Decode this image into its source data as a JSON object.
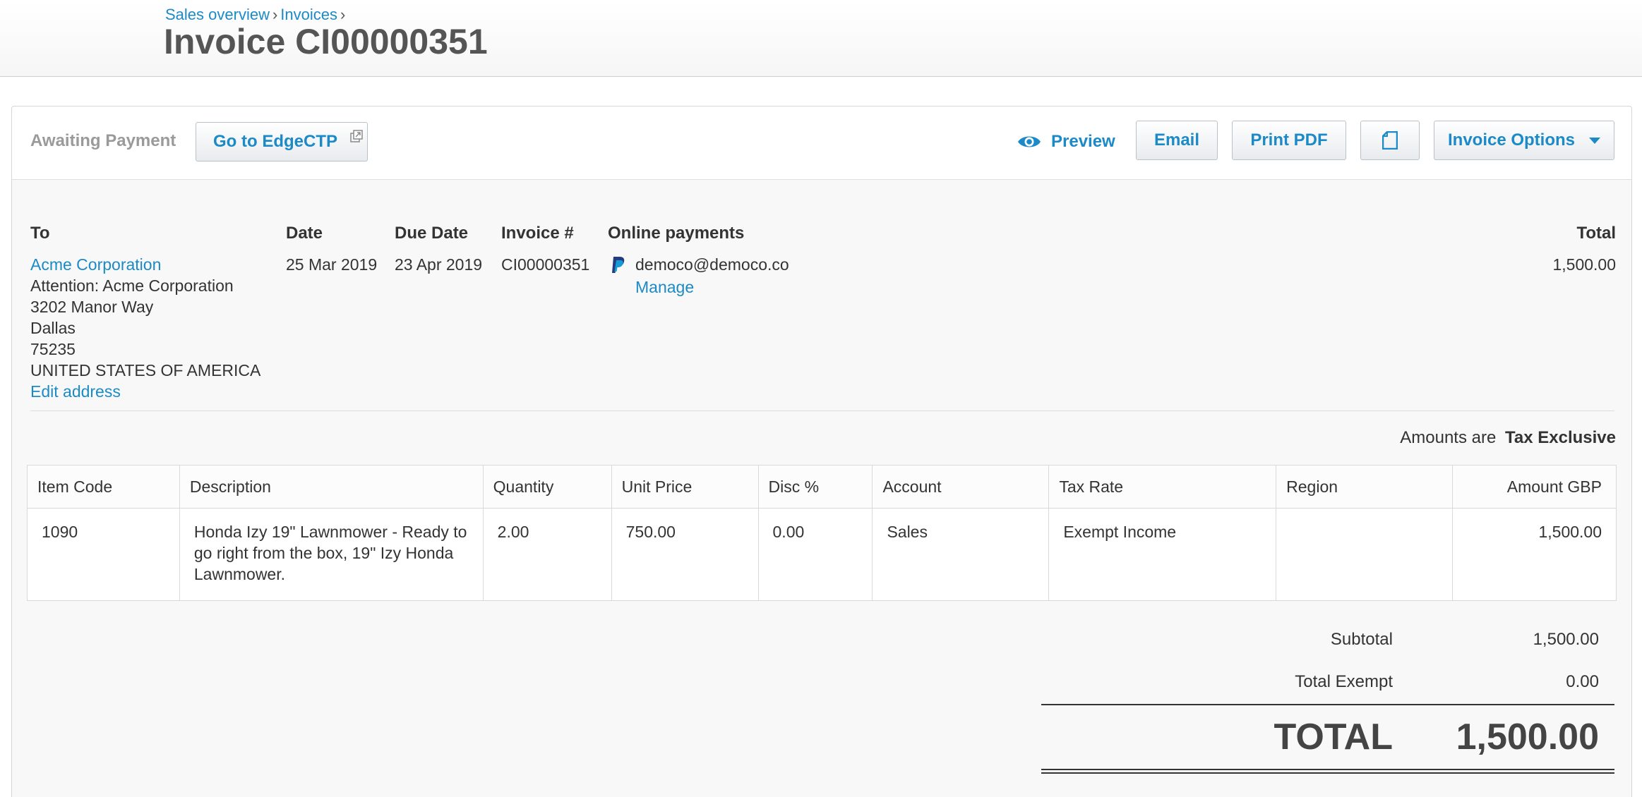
{
  "breadcrumb": {
    "items": [
      "Sales overview",
      "Invoices"
    ],
    "separator": "›"
  },
  "page_title": "Invoice CI00000351",
  "toolbar": {
    "status": "Awaiting Payment",
    "edge_button": "Go to EdgeCTP",
    "preview": "Preview",
    "email": "Email",
    "print_pdf": "Print PDF",
    "invoice_options": "Invoice Options"
  },
  "invoice": {
    "labels": {
      "to": "To",
      "date": "Date",
      "due_date": "Due Date",
      "invoice_no": "Invoice #",
      "online_payments": "Online payments",
      "total": "Total"
    },
    "contact": "Acme Corporation",
    "address_lines": [
      "Attention: Acme Corporation",
      "3202 Manor Way",
      "Dallas",
      "75235",
      "UNITED STATES OF AMERICA"
    ],
    "edit_address": "Edit address",
    "date": "25 Mar 2019",
    "due_date": "23 Apr 2019",
    "number": "CI00000351",
    "payment_email": "democo@democo.co",
    "manage": "Manage",
    "total": "1,500.00"
  },
  "amounts_note": {
    "prefix": "Amounts are",
    "value": "Tax Exclusive"
  },
  "table": {
    "headers": [
      "Item Code",
      "Description",
      "Quantity",
      "Unit Price",
      "Disc %",
      "Account",
      "Tax Rate",
      "Region",
      "Amount GBP"
    ],
    "rows": [
      {
        "item_code": "1090",
        "description": "Honda Izy 19\" Lawnmower - Ready to go right from the box, 19\" Izy Honda Lawnmower.",
        "quantity": "2.00",
        "unit_price": "750.00",
        "disc": "0.00",
        "account": "Sales",
        "tax_rate": "Exempt Income",
        "region": "",
        "amount": "1,500.00"
      }
    ]
  },
  "totals": {
    "subtotal_label": "Subtotal",
    "subtotal": "1,500.00",
    "exempt_label": "Total Exempt",
    "exempt": "0.00",
    "total_label": "TOTAL",
    "total": "1,500.00"
  },
  "colors": {
    "link": "#1b8ac6",
    "title": "#555555",
    "paypal_dark": "#253b80",
    "paypal_light": "#179bd7"
  }
}
